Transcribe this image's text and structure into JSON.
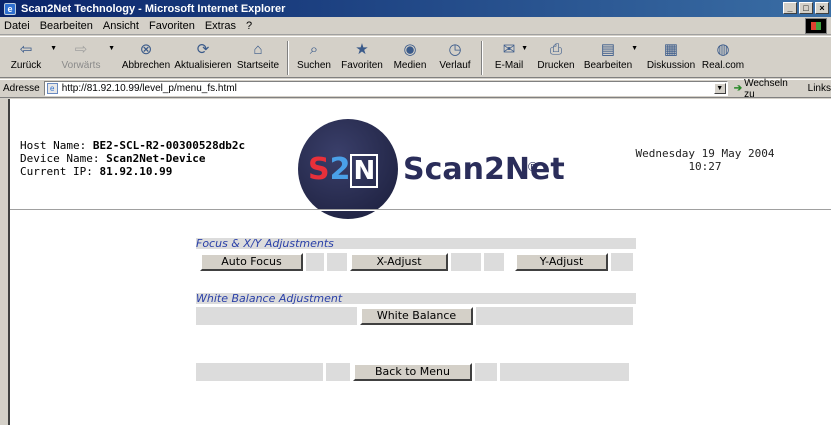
{
  "window": {
    "title": "Scan2Net Technology - Microsoft Internet Explorer",
    "buttons": [
      "_",
      "□",
      "×"
    ]
  },
  "menu": [
    "Datei",
    "Bearbeiten",
    "Ansicht",
    "Favoriten",
    "Extras",
    "?"
  ],
  "toolbar": {
    "back": "Zurück",
    "forward": "Vorwärts",
    "stop": "Abbrechen",
    "refresh": "Aktualisieren",
    "home": "Startseite",
    "search": "Suchen",
    "favorites": "Favoriten",
    "media": "Medien",
    "history": "Verlauf",
    "mail": "E-Mail",
    "print": "Drucken",
    "edit": "Bearbeiten",
    "discuss": "Diskussion",
    "realcom": "Real.com"
  },
  "address": {
    "label": "Adresse",
    "url": "http://81.92.10.99/level_p/menu_fs.html",
    "go": "Wechseln zu",
    "links": "Links"
  },
  "device": {
    "host_label": "Host Name:",
    "host_value": "BE2-SCL-R2-00300528db2c",
    "device_label": "Device Name:",
    "device_value": "Scan2Net-Device",
    "ip_label": "Current IP:",
    "ip_value": "81.92.10.99"
  },
  "logo": {
    "mark_s": "S",
    "mark_2": "2",
    "mark_n": "N",
    "brand": "Scan2Net",
    "reg": "®"
  },
  "datetime": {
    "date": "Wednesday 19 May 2004",
    "time": "10:27"
  },
  "sections": {
    "focus_title": "Focus & X/Y Adjustments",
    "auto_focus": "Auto Focus",
    "x_adjust": "X-Adjust",
    "y_adjust": "Y-Adjust",
    "wb_title": "White Balance Adjustment",
    "white_balance": "White Balance",
    "back_to_menu": "Back to Menu"
  }
}
